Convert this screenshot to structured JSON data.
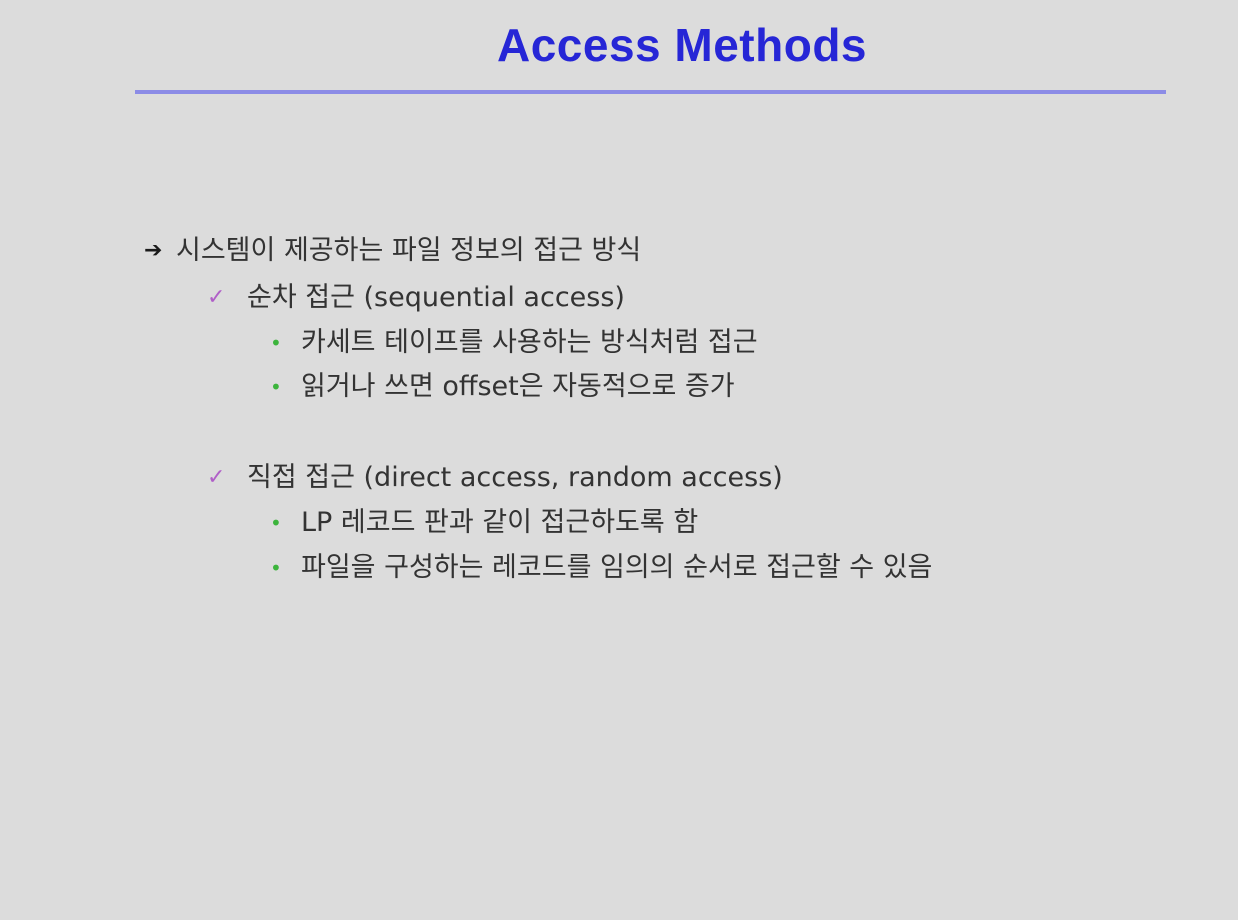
{
  "slide": {
    "title": "Access Methods",
    "accent_color": "#2626d6",
    "rule_color": "#8c8ce6",
    "items": [
      {
        "level": 1,
        "bullet": "arrow-bullet",
        "text": "시스템이 제공하는 파일 정보의 접근 방식"
      },
      {
        "level": 2,
        "bullet": "check-bullet",
        "text": "순차 접근 (sequential access)"
      },
      {
        "level": 3,
        "bullet": "dot-bullet",
        "text": "카세트 테이프를 사용하는 방식처럼 접근"
      },
      {
        "level": 3,
        "bullet": "dot-bullet",
        "text": "읽거나 쓰면 offset은 자동적으로 증가"
      },
      {
        "level": 2,
        "bullet": "check-bullet",
        "text": "직접 접근 (direct access, random access)"
      },
      {
        "level": 3,
        "bullet": "dot-bullet",
        "text": "LP 레코드 판과 같이 접근하도록 함"
      },
      {
        "level": 3,
        "bullet": "dot-bullet",
        "text": "파일을 구성하는 레코드를 임의의 순서로 접근할 수 있음"
      }
    ]
  }
}
